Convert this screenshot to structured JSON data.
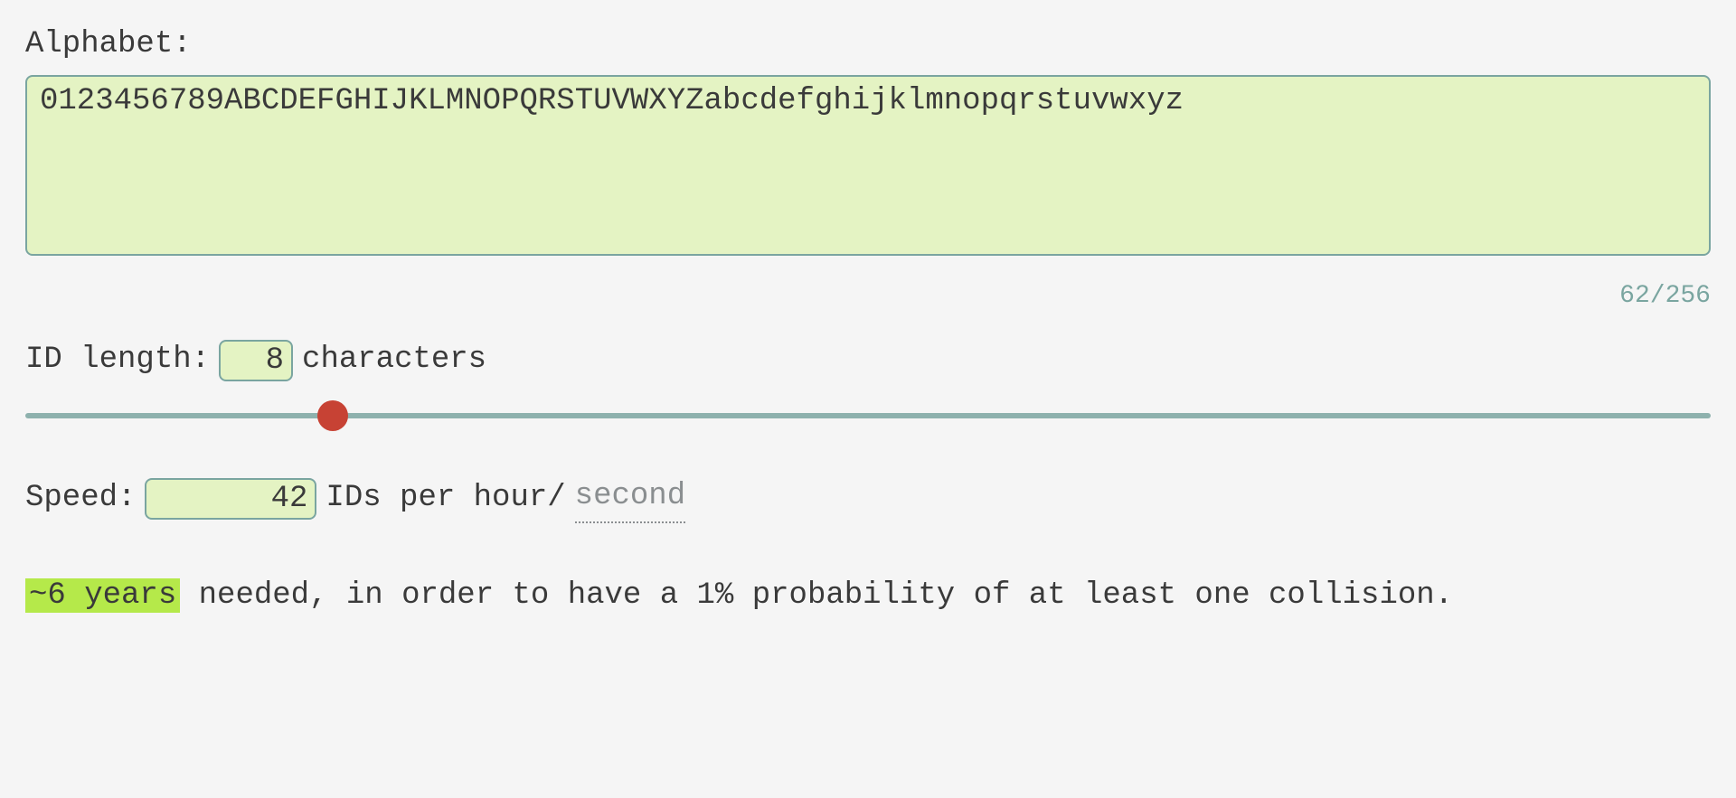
{
  "alphabet": {
    "label": "Alphabet:",
    "value": "0123456789ABCDEFGHIJKLMNOPQRSTUVWXYZabcdefghijklmnopqrstuvwxyz",
    "counter": "62/256"
  },
  "length": {
    "label_pre": "ID length:",
    "value": "8",
    "label_post": "characters",
    "slider": {
      "min": "2",
      "max": "36",
      "value": "8"
    }
  },
  "speed": {
    "label_pre": "Speed:",
    "value": "42",
    "label_post": "IDs per hour/",
    "alt_unit": "second"
  },
  "result": {
    "highlight": "~6 years",
    "tail": " needed, in order to have a 1% probability of at least one collision."
  }
}
